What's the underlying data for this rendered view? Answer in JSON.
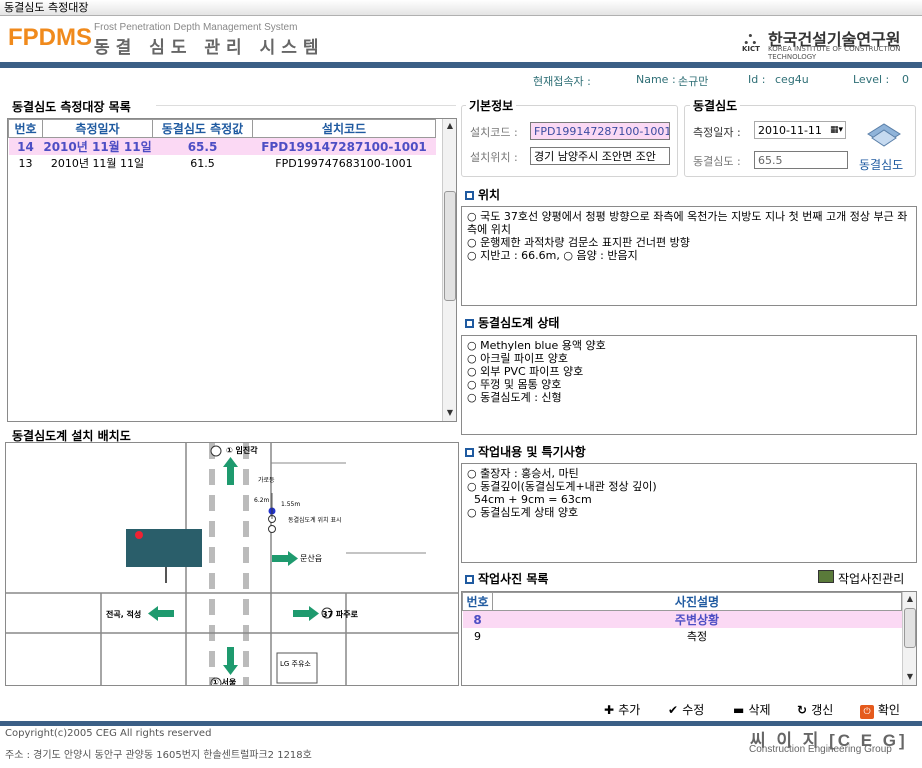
{
  "window": {
    "title": "동결심도 측정대장"
  },
  "logo": {
    "brand": "FPDMS",
    "subtitle_en": "Frost Penetration Depth Management System",
    "subtitle_kr": "동결 심도 관리 시스템"
  },
  "kict": {
    "name": "한국건설기술연구원",
    "abbr": "KICT",
    "sub": "KOREA INSTITUTE OF CONSTRUCTION TECHNOLOGY"
  },
  "session": {
    "label": "현재접속자 :",
    "name_label": "Name :",
    "name": "손규만",
    "id_label": "Id :",
    "id": "ceg4u",
    "level_label": "Level :",
    "level": "0"
  },
  "list": {
    "title": "동결심도 측정대장 목록",
    "columns": [
      "번호",
      "측정일자",
      "동결심도 측정값",
      "설치코드"
    ],
    "rows": [
      {
        "no": "14",
        "date": "2010년 11월 11일",
        "value": "65.5",
        "code": "FPD199147287100-1001",
        "selected": true
      },
      {
        "no": "13",
        "date": "2010년 11월 11일",
        "value": "61.5",
        "code": "FPD199747683100-1001",
        "selected": false
      }
    ]
  },
  "basic_info": {
    "title": "기본정보",
    "code_label": "설치코드 :",
    "code_value": "FPD199147287100-1001",
    "location_label": "설치위치 :",
    "location_value": "경기 남양주시 조안면 조안"
  },
  "frost": {
    "title": "동결심도",
    "date_label": "측정일자 :",
    "date_value": "2010-11-11",
    "depth_label": "동결심도 :",
    "depth_value": "65.5",
    "button_label": "동결심도"
  },
  "location_section": {
    "title": "위치",
    "lines": [
      "○ 국도 37호선 양평에서 청평 방향으로 좌측에 옥천가는 지방도 지나 첫 번째 고개 정상 부근 좌측에 위치",
      "○ 운행제한 과적차량 검문소 표지판 건너편 방향",
      "○ 지반고 : 66.6m,   ○ 음양 : 반음지"
    ]
  },
  "status_section": {
    "title": "동결심도계 상태",
    "lines": [
      "○ Methylen blue 용액 양호",
      "○ 아크릴 파이프 양호",
      "○ 외부 PVC 파이프 양호",
      "○ 뚜껑 및 몸통 양호",
      "○ 동결심도계 : 신형"
    ]
  },
  "work_section": {
    "title": "작업내용 및 특기사항",
    "lines": [
      "○ 출장자 : 홍승서, 마틴",
      "○ 동결깊이(동결심도계+내관 정상 깊이)",
      "  54cm + 9cm = 63cm",
      "○ 동결심도계 상태 양호"
    ]
  },
  "photo_section": {
    "title": "작업사진 목록",
    "manage_label": "작업사진관리",
    "columns": [
      "번호",
      "사진설명"
    ],
    "rows": [
      {
        "no": "8",
        "desc": "주변상황",
        "selected": true
      },
      {
        "no": "9",
        "desc": "측정",
        "selected": false
      }
    ]
  },
  "layout_section": {
    "title": "동결심도계 설치 배치도",
    "labels": {
      "north": "① 임진각",
      "south": "① 서울",
      "west": "전곡, 적성",
      "east": "37 파주로",
      "east2": "문산읍",
      "shop": "LG 주유소",
      "sign": "가로등",
      "m1": "6.2m",
      "m2": "1.55m",
      "note": "동결심도계 위치 표시"
    }
  },
  "actions": {
    "add": "추가",
    "edit": "수정",
    "delete": "삭제",
    "refresh": "갱신",
    "confirm": "확인"
  },
  "footer": {
    "copyright": "Copyright(c)2005 CEG All rights reserved",
    "address": "주소 : 경기도 안양시 동안구 관양동 1605번지 한솔센트럴파크2 1218호",
    "ceg_kr": "씨 이 지 [C E G]",
    "ceg_en": "Construction Engineering Group"
  },
  "colors": {
    "accent_bar": "#3b5f86",
    "brand_orange": "#f08a1c",
    "selected_row": "#fbd9f4",
    "header_text": "#1f5aa0"
  }
}
